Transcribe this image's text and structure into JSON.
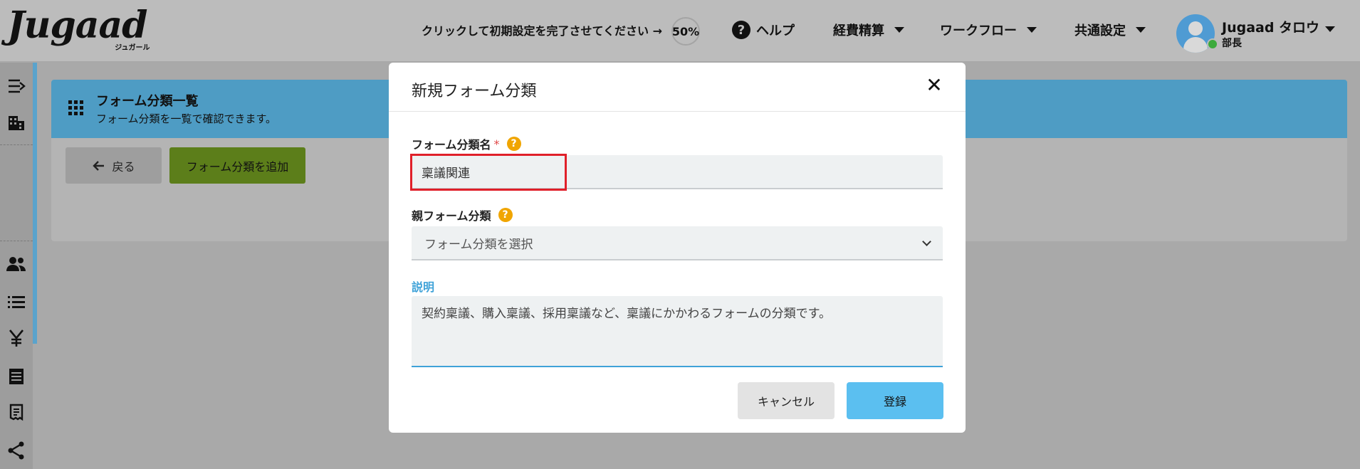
{
  "header": {
    "logo_text": "Jugaad",
    "logo_sub": "ジュガール",
    "setup_text": "クリックして初期設定を完了させてください →",
    "setup_progress": "50%",
    "help_label": "ヘルプ",
    "menu_expense": "経費精算",
    "menu_workflow": "ワークフロー",
    "menu_common": "共通設定",
    "user_name": "Jugaad タロウ",
    "user_role": "部長"
  },
  "page": {
    "banner_title": "フォーム分類一覧",
    "banner_subtitle": "フォーム分類を一覧で確認できます。",
    "back_label": "戻る",
    "add_label": "フォーム分類を追加"
  },
  "modal": {
    "title": "新規フォーム分類",
    "close_glyph": "✕",
    "name_label": "フォーム分類名",
    "required_mark": "*",
    "name_value": "稟議関連",
    "parent_label": "親フォーム分類",
    "parent_placeholder": "フォーム分類を選択",
    "description_label": "説明",
    "description_value": "契約稟議、購入稟議、採用稟議など、稟議にかかわるフォームの分類です。",
    "cancel_label": "キャンセル",
    "submit_label": "登録"
  },
  "colors": {
    "accent_blue": "#5bbff0",
    "banner_blue": "#4e9cc4",
    "add_green": "#5c7e1a",
    "required_red": "#e04848",
    "help_yellow": "#f0a500",
    "highlight_red": "#e0202a"
  }
}
